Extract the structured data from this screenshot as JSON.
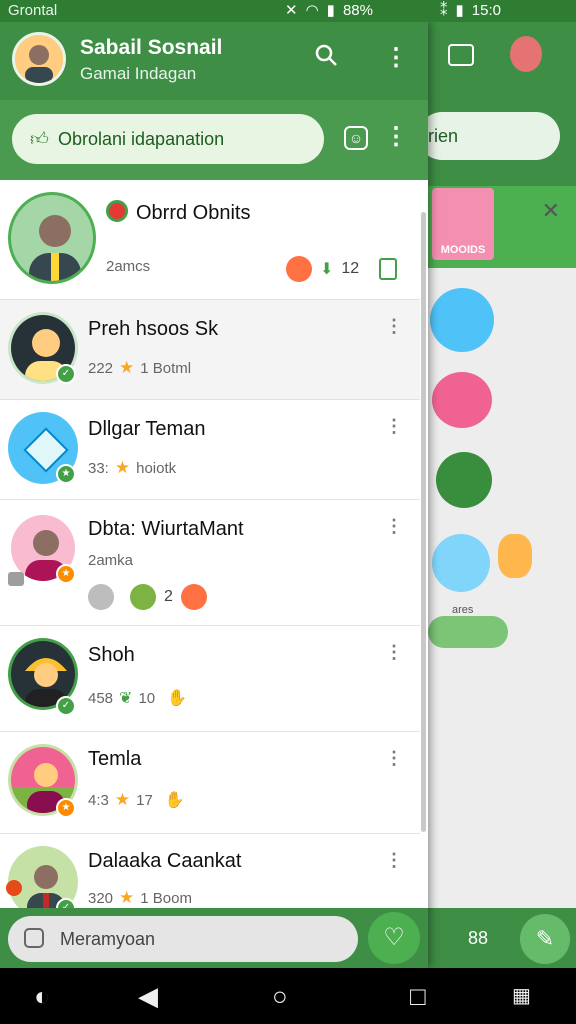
{
  "status_bar": {
    "carrier": "Grontal",
    "battery": "88%",
    "time": "15:0"
  },
  "app": {
    "title": "Sabail Sosnail",
    "subtitle": "Gamai Indagan"
  },
  "sub_bar": {
    "pill_text": "Obrolani idapanation"
  },
  "chats": [
    {
      "name": "Obrrd Obnits",
      "meta": "2amcs",
      "count": "12"
    },
    {
      "name": "Preh hsoos Sk",
      "number": "222",
      "status": "1 Botml"
    },
    {
      "name": "Dllgar Teman",
      "number": "33:",
      "status": "hoiotk"
    },
    {
      "name": "Dbta: WiurtaMant",
      "meta": "2amka",
      "count": "2"
    },
    {
      "name": "Shoh",
      "number": "458",
      "count": "10"
    },
    {
      "name": "Temla",
      "number": "4:3",
      "count": "17"
    },
    {
      "name": "Dalaaka Caankat",
      "number": "320",
      "status": "1 Boom"
    }
  ],
  "compose": {
    "placeholder": "Meramyoan"
  },
  "background": {
    "search_text": "rien",
    "card_label": "MOOIDS",
    "bottom_label": "88",
    "sticker_label": "ares"
  },
  "colors": {
    "primary": "#3e8e45",
    "accent": "#4caf50",
    "star": "#f9a825"
  }
}
